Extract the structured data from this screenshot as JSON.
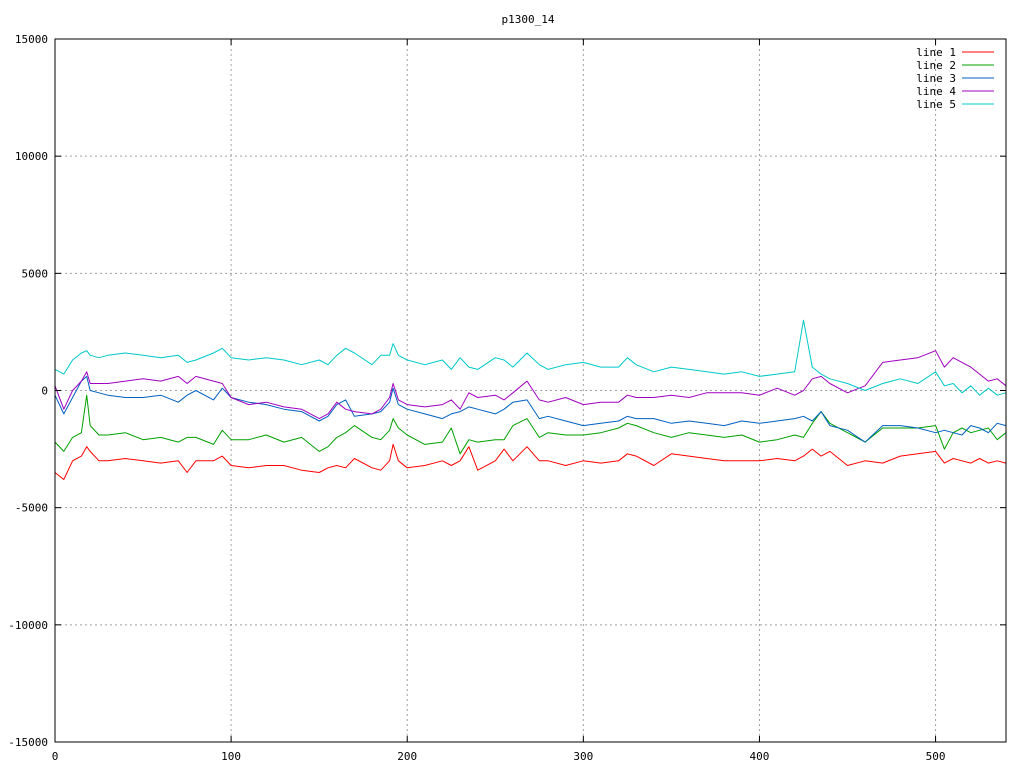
{
  "chart_data": {
    "type": "line",
    "title": "p1300_14",
    "xlabel": "",
    "ylabel": "",
    "xlim": [
      0,
      540
    ],
    "ylim": [
      -15000,
      15000
    ],
    "grid": true,
    "legend_position": "top-right",
    "x_ticks": [
      0,
      100,
      200,
      300,
      400,
      500
    ],
    "y_ticks": [
      -15000,
      -10000,
      -5000,
      0,
      5000,
      10000,
      15000
    ],
    "x": [
      0,
      5,
      10,
      15,
      18,
      20,
      25,
      30,
      40,
      50,
      60,
      70,
      75,
      80,
      90,
      95,
      100,
      110,
      120,
      130,
      140,
      150,
      155,
      160,
      165,
      170,
      180,
      185,
      190,
      192,
      195,
      200,
      210,
      220,
      225,
      230,
      235,
      240,
      250,
      255,
      260,
      268,
      275,
      280,
      290,
      300,
      310,
      320,
      325,
      330,
      340,
      350,
      360,
      370,
      380,
      390,
      400,
      410,
      420,
      425,
      430,
      435,
      440,
      450,
      460,
      470,
      480,
      490,
      500,
      505,
      510,
      515,
      520,
      525,
      530,
      535,
      540
    ],
    "series": [
      {
        "name": "line 1",
        "color": "#ff0000",
        "values": [
          -3500,
          -3800,
          -3000,
          -2800,
          -2400,
          -2600,
          -3000,
          -3000,
          -2900,
          -3000,
          -3100,
          -3000,
          -3500,
          -3000,
          -3000,
          -2800,
          -3200,
          -3300,
          -3200,
          -3200,
          -3400,
          -3500,
          -3300,
          -3200,
          -3300,
          -2900,
          -3300,
          -3400,
          -3000,
          -2300,
          -3000,
          -3300,
          -3200,
          -3000,
          -3200,
          -3000,
          -2400,
          -3400,
          -3000,
          -2500,
          -3000,
          -2400,
          -3000,
          -3000,
          -3200,
          -3000,
          -3100,
          -3000,
          -2700,
          -2800,
          -3200,
          -2700,
          -2800,
          -2900,
          -3000,
          -3000,
          -3000,
          -2900,
          -3000,
          -2800,
          -2500,
          -2800,
          -2600,
          -3200,
          -3000,
          -3100,
          -2800,
          -2700,
          -2600,
          -3100,
          -2900,
          -3000,
          -3100,
          -2900,
          -3100,
          -3000,
          -3100
        ]
      },
      {
        "name": "line 2",
        "color": "#00a000",
        "values": [
          -2200,
          -2600,
          -2000,
          -1800,
          -200,
          -1500,
          -1900,
          -1900,
          -1800,
          -2100,
          -2000,
          -2200,
          -2000,
          -2000,
          -2300,
          -1700,
          -2100,
          -2100,
          -1900,
          -2200,
          -2000,
          -2600,
          -2400,
          -2000,
          -1800,
          -1500,
          -2000,
          -2100,
          -1700,
          -1200,
          -1600,
          -1900,
          -2300,
          -2200,
          -1600,
          -2700,
          -2100,
          -2200,
          -2100,
          -2100,
          -1500,
          -1200,
          -2000,
          -1800,
          -1900,
          -1900,
          -1800,
          -1600,
          -1400,
          -1500,
          -1800,
          -2000,
          -1800,
          -1900,
          -2000,
          -1900,
          -2200,
          -2100,
          -1900,
          -2000,
          -1400,
          -900,
          -1400,
          -1800,
          -2200,
          -1600,
          -1600,
          -1600,
          -1500,
          -2500,
          -1800,
          -1600,
          -1800,
          -1700,
          -1600,
          -2100,
          -1800
        ]
      },
      {
        "name": "line 3",
        "color": "#0060c0",
        "values": [
          -200,
          -1000,
          -300,
          400,
          600,
          0,
          -100,
          -200,
          -300,
          -300,
          -200,
          -500,
          -200,
          0,
          -400,
          100,
          -300,
          -500,
          -600,
          -800,
          -900,
          -1300,
          -1100,
          -600,
          -400,
          -1100,
          -1000,
          -900,
          -500,
          100,
          -600,
          -800,
          -1000,
          -1200,
          -1000,
          -900,
          -700,
          -800,
          -1000,
          -800,
          -500,
          -400,
          -1200,
          -1100,
          -1300,
          -1500,
          -1400,
          -1300,
          -1100,
          -1200,
          -1200,
          -1400,
          -1300,
          -1400,
          -1500,
          -1300,
          -1400,
          -1300,
          -1200,
          -1100,
          -1300,
          -900,
          -1500,
          -1700,
          -2200,
          -1500,
          -1500,
          -1600,
          -1800,
          -1700,
          -1800,
          -1900,
          -1500,
          -1600,
          -1800,
          -1400,
          -1500
        ]
      },
      {
        "name": "line 4",
        "color": "#a000c0",
        "values": [
          200,
          -800,
          0,
          400,
          800,
          300,
          300,
          300,
          400,
          500,
          400,
          600,
          300,
          600,
          400,
          300,
          -300,
          -600,
          -500,
          -700,
          -800,
          -1200,
          -1000,
          -500,
          -800,
          -900,
          -1000,
          -800,
          -300,
          300,
          -400,
          -600,
          -700,
          -600,
          -400,
          -800,
          -100,
          -300,
          -200,
          -400,
          -100,
          400,
          -400,
          -500,
          -300,
          -600,
          -500,
          -500,
          -200,
          -300,
          -300,
          -200,
          -300,
          -100,
          -100,
          -100,
          -200,
          100,
          -200,
          0,
          500,
          600,
          300,
          -100,
          200,
          1200,
          1300,
          1400,
          1700,
          1000,
          1400,
          1200,
          1000,
          700,
          400,
          500,
          200
        ]
      },
      {
        "name": "line 5",
        "color": "#00c8c8",
        "values": [
          900,
          700,
          1300,
          1600,
          1700,
          1500,
          1400,
          1500,
          1600,
          1500,
          1400,
          1500,
          1200,
          1300,
          1600,
          1800,
          1400,
          1300,
          1400,
          1300,
          1100,
          1300,
          1100,
          1500,
          1800,
          1600,
          1100,
          1500,
          1500,
          2000,
          1500,
          1300,
          1100,
          1300,
          900,
          1400,
          1000,
          900,
          1400,
          1300,
          1000,
          1600,
          1100,
          900,
          1100,
          1200,
          1000,
          1000,
          1400,
          1100,
          800,
          1000,
          900,
          800,
          700,
          800,
          600,
          700,
          800,
          3000,
          1000,
          700,
          500,
          300,
          0,
          300,
          500,
          300,
          800,
          200,
          300,
          -100,
          200,
          -200,
          100,
          -200,
          -100
        ]
      }
    ]
  }
}
